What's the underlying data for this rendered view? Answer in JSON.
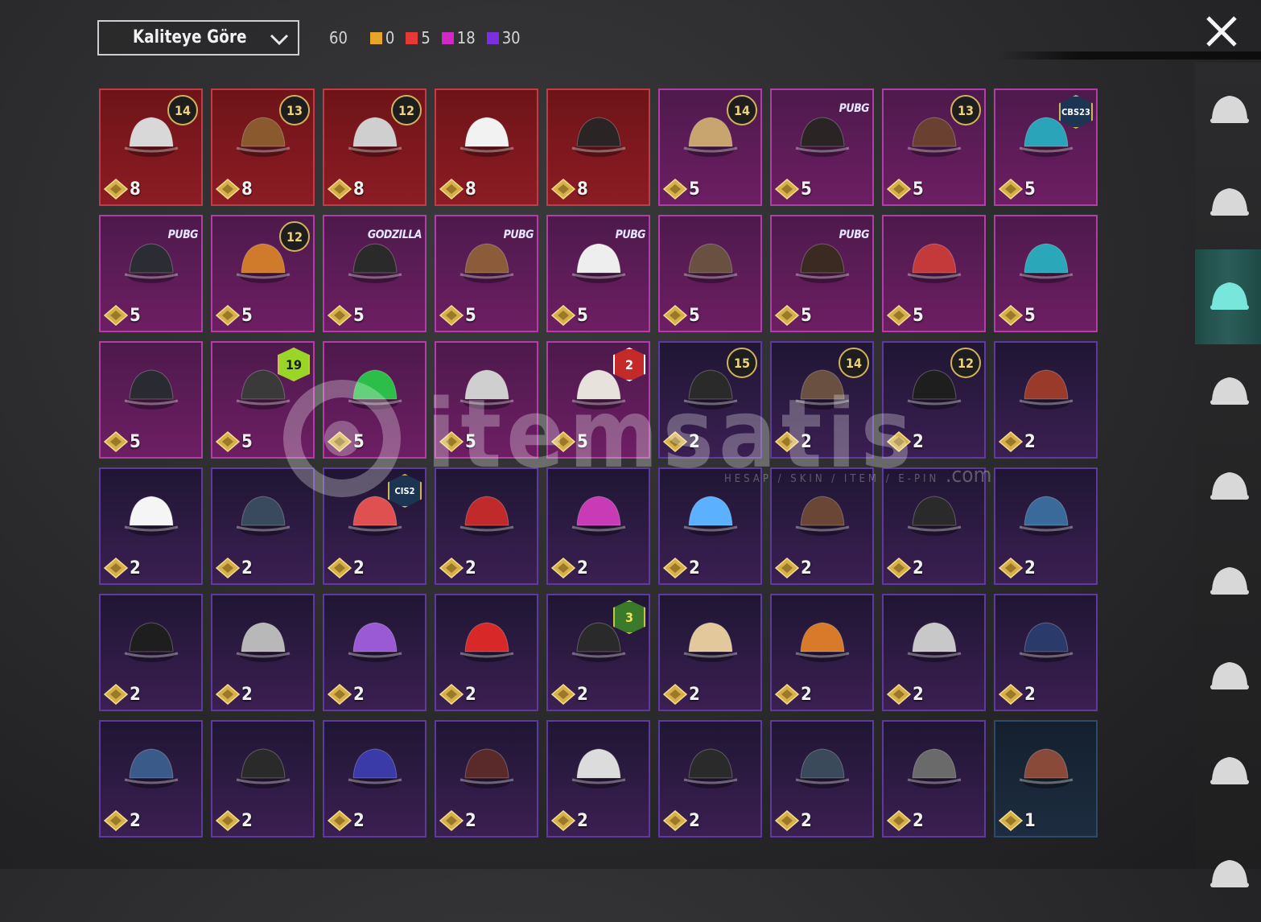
{
  "toolbar": {
    "sort_label": "Kaliteye Göre",
    "total": "60",
    "counts": [
      {
        "color": "#e8a628",
        "value": "0"
      },
      {
        "color": "#e53935",
        "value": "5"
      },
      {
        "color": "#d526c8",
        "value": "18"
      },
      {
        "color": "#7b2fe0",
        "value": "30"
      }
    ]
  },
  "watermark": {
    "text": "itemsatis",
    "domain": ".com",
    "subtitle": "HESAP / SKIN / ITEM / E-PIN"
  },
  "sidebar": {
    "tabs": [
      {
        "icon": "outfit-icon"
      },
      {
        "icon": "helmet-icon"
      },
      {
        "icon": "cap-icon",
        "active": true
      },
      {
        "icon": "glasses-icon"
      },
      {
        "icon": "mask-icon"
      },
      {
        "icon": "jacket-icon"
      },
      {
        "icon": "backpack-icon"
      },
      {
        "icon": "pants-icon"
      },
      {
        "icon": "shoes-icon"
      }
    ]
  },
  "items": [
    {
      "value": "8",
      "rarity": "red",
      "badge": "14",
      "badge_type": "hex",
      "icon": "horse-mask-icon"
    },
    {
      "value": "8",
      "rarity": "red",
      "badge": "13",
      "badge_type": "hex",
      "icon": "flower-hat-icon"
    },
    {
      "value": "8",
      "rarity": "red",
      "badge": "12",
      "badge_type": "hex",
      "icon": "white-hair-icon"
    },
    {
      "value": "8",
      "rarity": "red",
      "badge": "",
      "badge_type": "",
      "icon": "ghost-mask-icon"
    },
    {
      "value": "8",
      "rarity": "red",
      "badge": "",
      "badge_type": "",
      "icon": "pirate-hat-icon"
    },
    {
      "value": "5",
      "rarity": "magenta",
      "badge": "14",
      "badge_type": "hex",
      "icon": "blonde-hair-icon"
    },
    {
      "value": "5",
      "rarity": "magenta",
      "badge": "PUBG",
      "badge_type": "tag",
      "icon": "black-hair-icon"
    },
    {
      "value": "5",
      "rarity": "magenta",
      "badge": "13",
      "badge_type": "hex",
      "icon": "aviator-goggles-icon"
    },
    {
      "value": "5",
      "rarity": "magenta",
      "badge": "CBS23",
      "badge_type": "cbs",
      "icon": "cat-headphones-icon"
    },
    {
      "value": "5",
      "rarity": "magenta",
      "badge": "PUBG",
      "badge_type": "tag",
      "icon": "sunvisor-cap-icon"
    },
    {
      "value": "5",
      "rarity": "magenta",
      "badge": "12",
      "badge_type": "hex",
      "icon": "orange-hair-icon"
    },
    {
      "value": "5",
      "rarity": "magenta",
      "badge": "GODZILLA",
      "badge_type": "tag",
      "icon": "spiked-cap-icon"
    },
    {
      "value": "5",
      "rarity": "magenta",
      "badge": "PUBG",
      "badge_type": "tag",
      "icon": "llama-mask-icon"
    },
    {
      "value": "5",
      "rarity": "magenta",
      "badge": "PUBG",
      "badge_type": "tag",
      "icon": "panda-mask-icon"
    },
    {
      "value": "5",
      "rarity": "magenta",
      "badge": "",
      "badge_type": "",
      "icon": "ponytail-icon"
    },
    {
      "value": "5",
      "rarity": "magenta",
      "badge": "PUBG",
      "badge_type": "tag",
      "icon": "braided-hair-icon"
    },
    {
      "value": "5",
      "rarity": "magenta",
      "badge": "",
      "badge_type": "",
      "icon": "red-pigtails-icon"
    },
    {
      "value": "5",
      "rarity": "magenta",
      "badge": "",
      "badge_type": "",
      "icon": "robot-mask-icon"
    },
    {
      "value": "5",
      "rarity": "magenta",
      "badge": "",
      "badge_type": "",
      "icon": "balaclava-icon"
    },
    {
      "value": "5",
      "rarity": "magenta",
      "badge": "19",
      "badge_type": "season-s19",
      "icon": "bug-eye-mask-icon"
    },
    {
      "value": "5",
      "rarity": "magenta",
      "badge": "",
      "badge_type": "",
      "icon": "frog-hat-icon"
    },
    {
      "value": "5",
      "rarity": "magenta",
      "badge": "",
      "badge_type": "",
      "icon": "skull-balaclava-icon"
    },
    {
      "value": "5",
      "rarity": "magenta",
      "badge": "2",
      "badge_type": "season-s2",
      "icon": "rabbit-mask-icon"
    },
    {
      "value": "2",
      "rarity": "purple",
      "badge": "15",
      "badge_type": "hex",
      "icon": "pumpkin-beanie-icon"
    },
    {
      "value": "2",
      "rarity": "purple",
      "badge": "14",
      "badge_type": "hex",
      "icon": "cat-cap-hair-icon"
    },
    {
      "value": "2",
      "rarity": "purple",
      "badge": "12",
      "badge_type": "hex",
      "icon": "bunny-helmet-icon"
    },
    {
      "value": "2",
      "rarity": "purple",
      "badge": "",
      "badge_type": "",
      "icon": "goggle-hair-icon"
    },
    {
      "value": "2",
      "rarity": "purple",
      "badge": "",
      "badge_type": "",
      "icon": "sun-hat-icon"
    },
    {
      "value": "2",
      "rarity": "purple",
      "badge": "",
      "badge_type": "",
      "icon": "beanie-icon"
    },
    {
      "value": "2",
      "rarity": "purple",
      "badge": "CIS2",
      "badge_type": "cbs",
      "icon": "striped-beanie-icon"
    },
    {
      "value": "2",
      "rarity": "purple",
      "badge": "",
      "badge_type": "",
      "icon": "football-helmet-icon"
    },
    {
      "value": "2",
      "rarity": "purple",
      "badge": "",
      "badge_type": "",
      "icon": "punk-helmet-icon"
    },
    {
      "value": "2",
      "rarity": "purple",
      "badge": "",
      "badge_type": "",
      "icon": "bunny-headband-icon"
    },
    {
      "value": "2",
      "rarity": "purple",
      "badge": "",
      "badge_type": "",
      "icon": "cowboy-hat-icon"
    },
    {
      "value": "2",
      "rarity": "purple",
      "badge": "",
      "badge_type": "",
      "icon": "luchador-mask-icon"
    },
    {
      "value": "2",
      "rarity": "purple",
      "badge": "",
      "badge_type": "",
      "icon": "shark-hat-icon"
    },
    {
      "value": "2",
      "rarity": "purple",
      "badge": "",
      "badge_type": "",
      "icon": "top-hat-icon"
    },
    {
      "value": "2",
      "rarity": "purple",
      "badge": "",
      "badge_type": "",
      "icon": "shark-mask-icon"
    },
    {
      "value": "2",
      "rarity": "purple",
      "badge": "",
      "badge_type": "",
      "icon": "flower-crown-icon"
    },
    {
      "value": "2",
      "rarity": "purple",
      "badge": "",
      "badge_type": "",
      "icon": "bucket-hat-icon"
    },
    {
      "value": "2",
      "rarity": "purple",
      "badge": "3",
      "badge_type": "season-s3",
      "icon": "fedora-icon"
    },
    {
      "value": "2",
      "rarity": "purple",
      "badge": "",
      "badge_type": "",
      "icon": "cake-hat-icon"
    },
    {
      "value": "2",
      "rarity": "purple",
      "badge": "",
      "badge_type": "",
      "icon": "burger-hat-icon"
    },
    {
      "value": "2",
      "rarity": "purple",
      "badge": "",
      "badge_type": "",
      "icon": "head-mirror-icon"
    },
    {
      "value": "2",
      "rarity": "purple",
      "badge": "",
      "badge_type": "",
      "icon": "pilot-cap-icon"
    },
    {
      "value": "2",
      "rarity": "purple",
      "badge": "",
      "badge_type": "",
      "icon": "fez-icon"
    },
    {
      "value": "2",
      "rarity": "purple",
      "badge": "",
      "badge_type": "",
      "icon": "black-cap-icon"
    },
    {
      "value": "2",
      "rarity": "purple",
      "badge": "",
      "badge_type": "",
      "icon": "blue-cap-icon"
    },
    {
      "value": "2",
      "rarity": "purple",
      "badge": "",
      "badge_type": "",
      "icon": "maroon-fedora-icon"
    },
    {
      "value": "2",
      "rarity": "purple",
      "badge": "",
      "badge_type": "",
      "icon": "plaid-bandana-icon"
    },
    {
      "value": "2",
      "rarity": "purple",
      "badge": "",
      "badge_type": "",
      "icon": "camo-bucket-hat-icon"
    },
    {
      "value": "2",
      "rarity": "purple",
      "badge": "",
      "badge_type": "",
      "icon": "aviator-hat-icon"
    },
    {
      "value": "2",
      "rarity": "purple",
      "badge": "",
      "badge_type": "",
      "icon": "grey-fedora-icon"
    },
    {
      "value": "1",
      "rarity": "blue",
      "badge": "",
      "badge_type": "",
      "icon": "bandana-cap-icon"
    }
  ],
  "rarity_colors": {
    "red": "#8c1c24",
    "magenta": "#6d1e63",
    "purple": "#3b1f52",
    "blue": "#1d2c40"
  }
}
